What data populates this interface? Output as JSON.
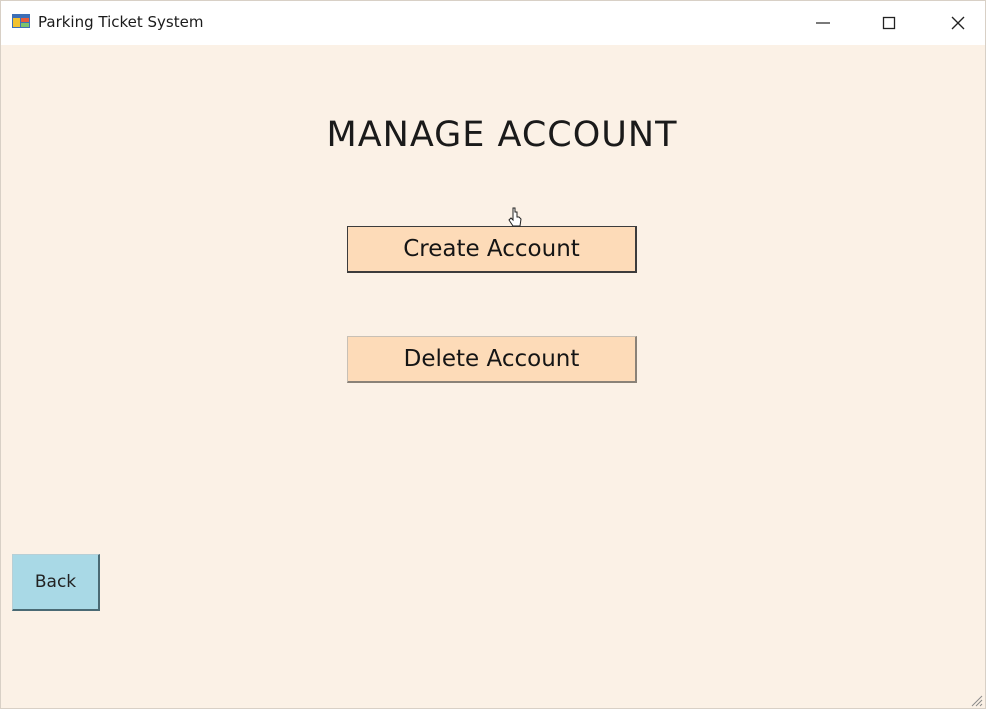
{
  "window": {
    "title": "Parking Ticket System",
    "controls": {
      "minimize_icon": "minimize-icon",
      "maximize_icon": "maximize-icon",
      "close_icon": "close-icon"
    }
  },
  "main": {
    "heading": "MANAGE ACCOUNT",
    "create_label": "Create Account",
    "delete_label": "Delete Account",
    "back_label": "Back"
  },
  "colors": {
    "background": "#fbf1e6",
    "action_button": "#fddbb8",
    "back_button": "#a9d9e6"
  }
}
